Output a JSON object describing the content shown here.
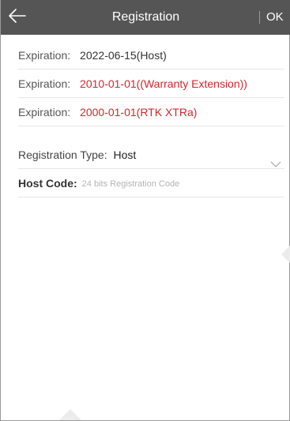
{
  "header": {
    "title": "Registration",
    "ok_label": "OK"
  },
  "expirations": [
    {
      "label": "Expiration:",
      "value": "2022-06-15(Host)",
      "color": "#333333"
    },
    {
      "label": "Expiration:",
      "value": "2010-01-01((Warranty Extension))",
      "color": "#d3272c"
    },
    {
      "label": "Expiration:",
      "value": "2000-01-01(RTK XTRa)",
      "color": "#d3272c"
    }
  ],
  "registration_type": {
    "label": "Registration Type:",
    "value": "Host"
  },
  "host_code": {
    "label": "Host Code:",
    "value": "",
    "placeholder": "24 bits Registration Code"
  },
  "icons": {
    "back": "back-arrow-icon",
    "dropdown": "chevron-down-icon"
  },
  "colors": {
    "header_bg": "#555555",
    "warning_text": "#d3272c"
  }
}
